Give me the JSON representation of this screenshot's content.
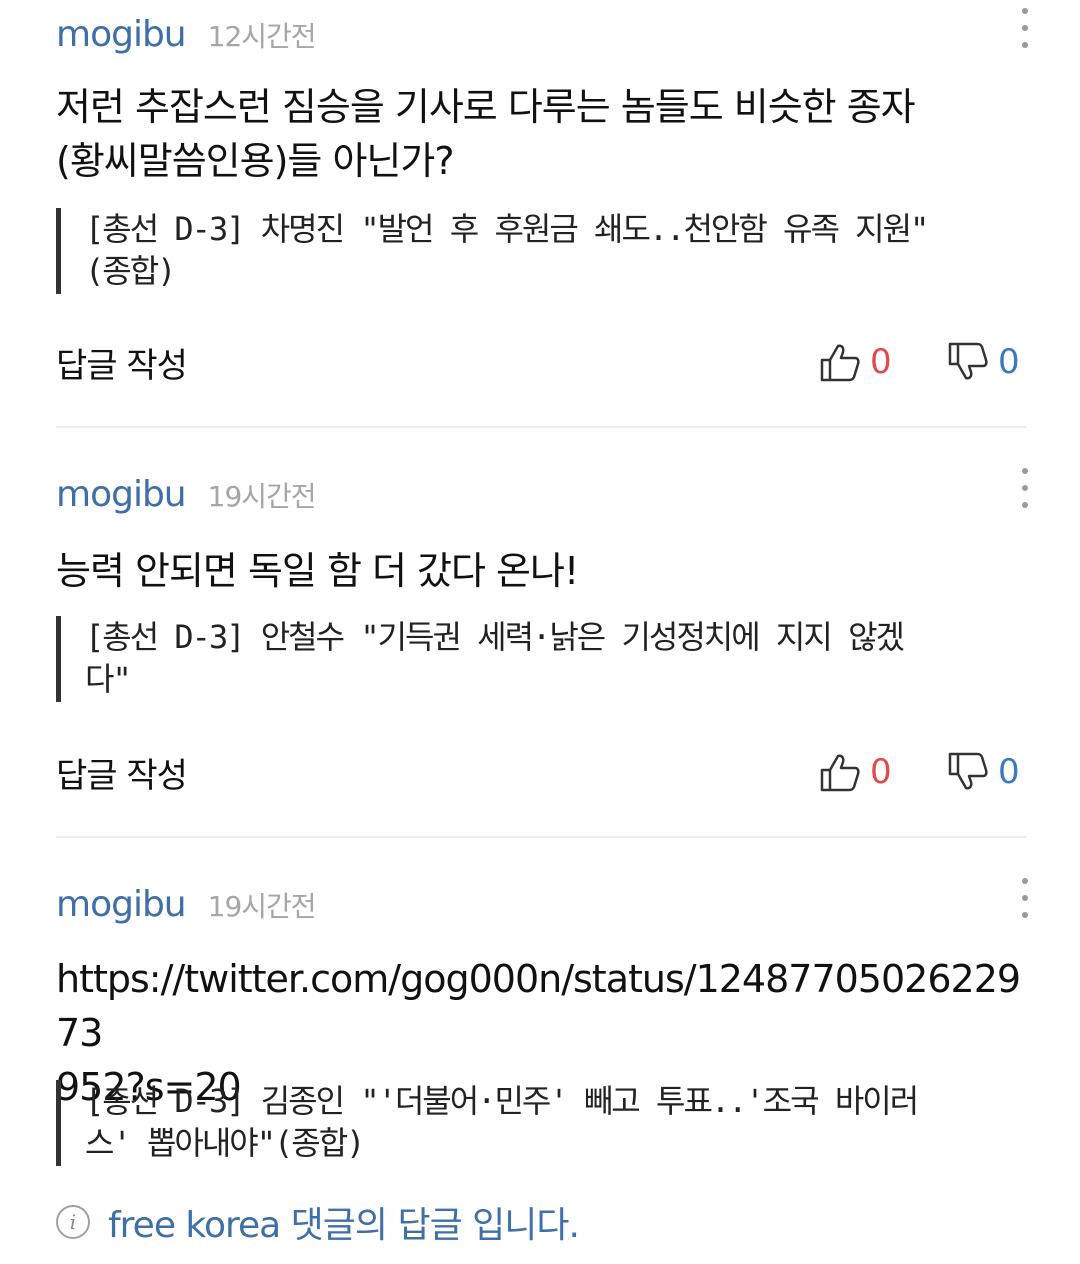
{
  "comments": [
    {
      "author": "mogibu",
      "time": "12시간전",
      "text": "저런 추잡스런 짐승을 기사로 다루는 놈들도 비슷한 종자\n(황씨말씀인용)들 아닌가?",
      "article": "[총선 D-3] 차명진 \"발언 후 후원금 쇄도..천안함 유족 지원\"\n(종합)",
      "reply_label": "답글 작성",
      "likes": "0",
      "dislikes": "0"
    },
    {
      "author": "mogibu",
      "time": "19시간전",
      "text": "능력 안되면 독일 함 더 갔다 온나!",
      "article": "[총선 D-3] 안철수 \"기득권 세력·낡은 기성정치에 지지 않겠\n다\"",
      "reply_label": "답글 작성",
      "likes": "0",
      "dislikes": "0"
    },
    {
      "author": "mogibu",
      "time": "19시간전",
      "text": "https://twitter.com/gog000n/status/1248770502622973\n952?s=20",
      "article": "[총선 D-3] 김종인 \"'더불어·민주' 빼고 투표..'조국 바이러\n스' 뽑아내야\"(종합)"
    }
  ],
  "reply_notice": "free korea 댓글의 답글 입니다.",
  "colors": {
    "author": "#3f6fa8",
    "like": "#e24a4a",
    "dislike": "#3b78c4"
  },
  "icons": {
    "more": "more-vertical-icon",
    "like": "thumbs-up-icon",
    "dislike": "thumbs-down-icon",
    "info": "info-icon"
  }
}
